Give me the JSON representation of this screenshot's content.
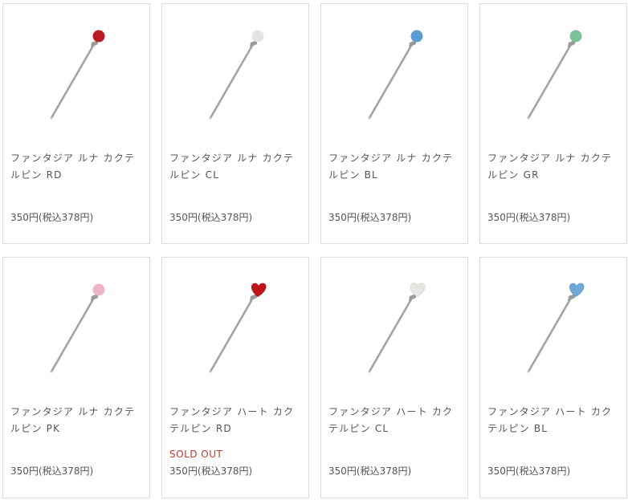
{
  "products": [
    {
      "name": "ファンタジア ルナ カクテルピン RD",
      "price": "350円(税込378円)",
      "sold_out": "",
      "shape": "ball",
      "color": "#b81c22"
    },
    {
      "name": "ファンタジア ルナ カクテルピン CL",
      "price": "350円(税込378円)",
      "sold_out": "",
      "shape": "ball",
      "color": "#e4e4e4"
    },
    {
      "name": "ファンタジア ルナ カクテルピン BL",
      "price": "350円(税込378円)",
      "sold_out": "",
      "shape": "ball",
      "color": "#5b9bd1"
    },
    {
      "name": "ファンタジア ルナ カクテルピン GR",
      "price": "350円(税込378円)",
      "sold_out": "",
      "shape": "ball",
      "color": "#7cc19a"
    },
    {
      "name": "ファンタジア ルナ カクテルピン PK",
      "price": "350円(税込378円)",
      "sold_out": "",
      "shape": "ball",
      "color": "#efb4c6"
    },
    {
      "name": "ファンタジア ハート カクテルピン RD",
      "price": "350円(税込378円)",
      "sold_out": "SOLD OUT",
      "shape": "heart",
      "color": "#c0141c"
    },
    {
      "name": "ファンタジア ハート カクテルピン CL",
      "price": "350円(税込378円)",
      "sold_out": "",
      "shape": "heart",
      "color": "#e8e6e3"
    },
    {
      "name": "ファンタジア ハート カクテルピン BL",
      "price": "350円(税込378円)",
      "sold_out": "",
      "shape": "heart",
      "color": "#6eaad9"
    }
  ]
}
